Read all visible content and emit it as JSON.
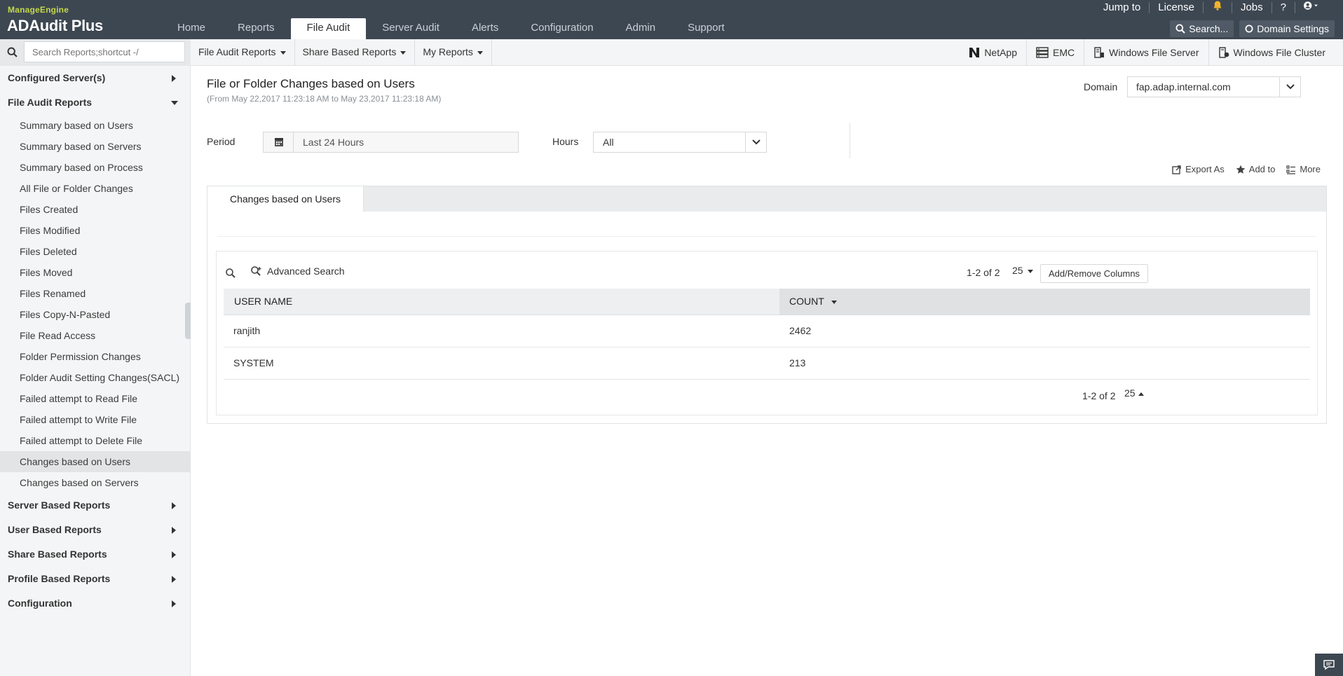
{
  "app": {
    "brand_small": "ManageEngine",
    "brand_name": "ADAudit Plus"
  },
  "colors": {
    "topbar": "#3d4752",
    "brand_accent": "#c3d84b",
    "alert_bell": "#f0b429"
  },
  "top_nav": {
    "tabs": [
      "Home",
      "Reports",
      "File Audit",
      "Server Audit",
      "Alerts",
      "Configuration",
      "Admin",
      "Support"
    ],
    "active": "File Audit"
  },
  "top_links": {
    "jump_to": "Jump to",
    "license": "License",
    "jobs": "Jobs",
    "help": "?",
    "search": "Search...",
    "domain_settings": "Domain Settings"
  },
  "search": {
    "placeholder": "Search Reports;shortcut -/"
  },
  "sub_nav": {
    "file_audit_reports": "File Audit Reports",
    "share_based_reports": "Share Based Reports",
    "my_reports": "My Reports",
    "netapp": "NetApp",
    "emc": "EMC",
    "windows_file_server": "Windows File Server",
    "windows_file_cluster": "Windows File Cluster"
  },
  "sidebar": {
    "configured_servers": "Configured Server(s)",
    "file_audit_reports": "File Audit Reports",
    "items": [
      "Summary based on Users",
      "Summary based on Servers",
      "Summary based on Process",
      "All File or Folder Changes",
      "Files Created",
      "Files Modified",
      "Files Deleted",
      "Files Moved",
      "Files Renamed",
      "Files Copy-N-Pasted",
      "File Read Access",
      "Folder Permission Changes",
      "Folder Audit Setting Changes(SACL)",
      "Failed attempt to Read File",
      "Failed attempt to Write File",
      "Failed attempt to Delete File",
      "Changes based on Users",
      "Changes based on Servers"
    ],
    "active_item": "Changes based on Users",
    "server_based_reports": "Server Based Reports",
    "user_based_reports": "User Based Reports",
    "share_based_reports": "Share Based Reports",
    "profile_based_reports": "Profile Based Reports",
    "configuration": "Configuration"
  },
  "report": {
    "title": "File or Folder Changes based on Users",
    "range": "(From May 22,2017 11:23:18 AM to May 23,2017 11:23:18 AM)",
    "domain_label": "Domain",
    "domain_value": "fap.adap.internal.com",
    "period_label": "Period",
    "period_value": "Last 24 Hours",
    "hours_label": "Hours",
    "hours_value": "All",
    "export_as": "Export As",
    "add_to": "Add to",
    "more": "More",
    "tab_label": "Changes based on Users"
  },
  "grid": {
    "advanced_search": "Advanced Search",
    "pager": "1-2 of 2",
    "page_size": "25",
    "add_remove_columns": "Add/Remove Columns",
    "columns": [
      "USER NAME",
      "COUNT"
    ],
    "rows": [
      [
        "ranjith",
        "2462"
      ],
      [
        "SYSTEM",
        "213"
      ]
    ]
  }
}
